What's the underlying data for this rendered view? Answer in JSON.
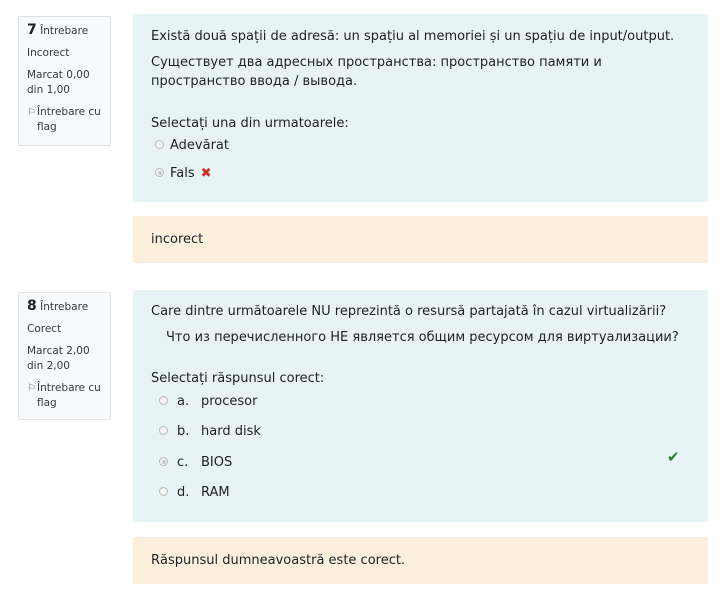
{
  "q7": {
    "number": "7",
    "word": "Întrebare",
    "state": "Incorect",
    "mark": "Marcat 0,00 din 1,00",
    "flag_label": "Întrebare cu flag",
    "text_ro": "Există două spații de adresă: un spațiu al memoriei și un spațiu de input/output.",
    "text_ru": "Существует два адресных пространства: пространство памяти и пространство ввода / вывода.",
    "prompt": "Selectați una din urmatoarele:",
    "options": [
      {
        "label": "Adevărat",
        "selected": false
      },
      {
        "label": "Fals",
        "selected": true,
        "result": "incorrect"
      }
    ],
    "feedback": "incorect"
  },
  "q8": {
    "number": "8",
    "word": "Întrebare",
    "state": "Corect",
    "mark": "Marcat 2,00 din 2,00",
    "flag_label": "Întrebare cu flag",
    "text_ro": "Care dintre următoarele NU reprezintă o resursă partajată în cazul virtualizării?",
    "text_ru": "Что из перечисленного НЕ является общим ресурсом для виртуализации?",
    "prompt": "Selectați răspunsul corect:",
    "options": [
      {
        "letter": "a.",
        "label": "procesor",
        "selected": false
      },
      {
        "letter": "b.",
        "label": "hard disk",
        "selected": false
      },
      {
        "letter": "c.",
        "label": "BIOS",
        "selected": true,
        "result": "correct"
      },
      {
        "letter": "d.",
        "label": "RAM",
        "selected": false
      }
    ],
    "feedback": "Răspunsul dumneavoastră este corect."
  },
  "icons": {
    "flag": "flag-icon",
    "incorrect": "cross-icon",
    "correct": "check-icon"
  },
  "colors": {
    "question_bg": "#e7f3f5",
    "feedback_bg": "#fcefdc",
    "incorrect": "#ca3120",
    "correct": "#357a32"
  }
}
